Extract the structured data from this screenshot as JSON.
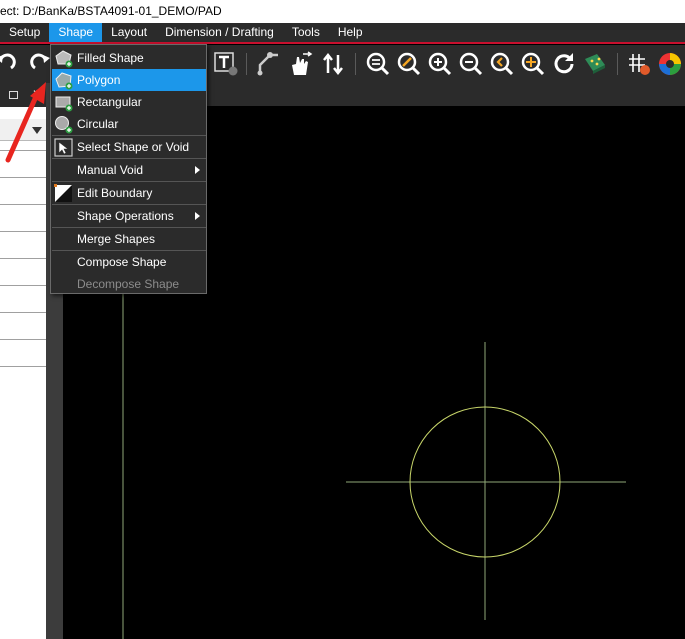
{
  "window": {
    "title": "ect: D:/BanKa/BSTA4091-01_DEMO/PAD"
  },
  "menubar": {
    "items": [
      {
        "label": "Setup"
      },
      {
        "label": "Shape",
        "active": true
      },
      {
        "label": "Layout"
      },
      {
        "label": "Dimension / Drafting"
      },
      {
        "label": "Tools"
      },
      {
        "label": "Help"
      }
    ]
  },
  "shape_menu": {
    "items": [
      {
        "label": "Filled Shape",
        "icon": "filled-shape-icon"
      },
      {
        "label": "Polygon",
        "icon": "polygon-icon",
        "highlighted": true
      },
      {
        "label": "Rectangular",
        "icon": "rectangular-icon"
      },
      {
        "label": "Circular",
        "icon": "circular-icon"
      },
      {
        "label": "Select Shape or Void",
        "icon": "select-shape-icon"
      },
      {
        "label": "Manual Void",
        "submenu": true
      },
      {
        "label": "Edit Boundary",
        "icon": "edit-boundary-icon"
      },
      {
        "label": "Shape Operations",
        "submenu": true
      },
      {
        "label": "Merge Shapes"
      },
      {
        "label": "Compose Shape"
      },
      {
        "label": "Decompose Shape",
        "disabled": true
      }
    ]
  },
  "toolbar": {
    "icons": [
      "undo-icon",
      "redo-icon",
      "text-icon",
      "route-icon",
      "slide-icon",
      "swap-icon",
      "zoom-world-icon",
      "zoom-fit-icon",
      "zoom-in-icon",
      "zoom-out-icon",
      "zoom-previous-icon",
      "zoom-center-icon",
      "refresh-icon",
      "board-3d-icon",
      "grid-icon",
      "color-icon"
    ]
  },
  "colors": {
    "menubar_bg": "#2b2b2b",
    "accent": "#1c97ea",
    "menubar_border": "#c8102e",
    "canvas_bg": "#000000",
    "shape_outline": "#c8d66a",
    "crosshair": "#8fa878"
  }
}
